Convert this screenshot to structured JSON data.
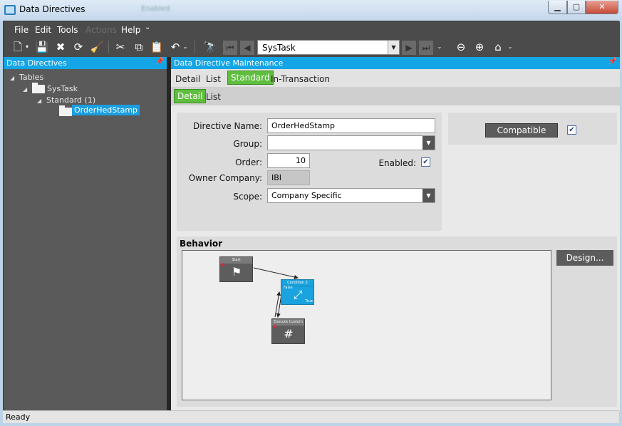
{
  "window": {
    "title": "Data Directives",
    "blurred_text": "Enabled"
  },
  "menu": [
    "File",
    "Edit",
    "Tools",
    "Actions",
    "Help"
  ],
  "toolbar": {
    "nav_combo_value": "SysTask"
  },
  "left_panel": {
    "header": "Data Directives",
    "tree": {
      "root": "Tables",
      "table": "SysTask",
      "group": "Standard (1)",
      "item": "OrderHedStamp"
    }
  },
  "right_panel": {
    "header": "Data Directive Maintenance",
    "tabs": [
      "Detail",
      "List",
      "Standard",
      "In-Transaction"
    ],
    "subtabs": [
      "Detail",
      "List"
    ],
    "form": {
      "directive_name_label": "Directive Name:",
      "directive_name_value": "OrderHedStamp",
      "group_label": "Group:",
      "group_value": "",
      "order_label": "Order:",
      "order_value": "10",
      "enabled_label": "Enabled:",
      "enabled_checked": true,
      "owner_company_label": "Owner Company:",
      "owner_company_value": "IBI",
      "scope_label": "Scope:",
      "scope_value": "Company Specific"
    },
    "compatible": {
      "label": "Compatible",
      "checked": true
    },
    "behavior": {
      "title": "Behavior",
      "design_button": "Design...",
      "nodes": {
        "start": "Start",
        "condition": "Condition 2",
        "condition_true": "True",
        "condition_false": "False",
        "execute": "Execute Custom Co"
      }
    }
  },
  "status": "Ready",
  "colors": {
    "accent_blue": "#13a5e6",
    "active_tab_green": "#5fbe3e",
    "dark_bg": "#4b4b4b"
  }
}
